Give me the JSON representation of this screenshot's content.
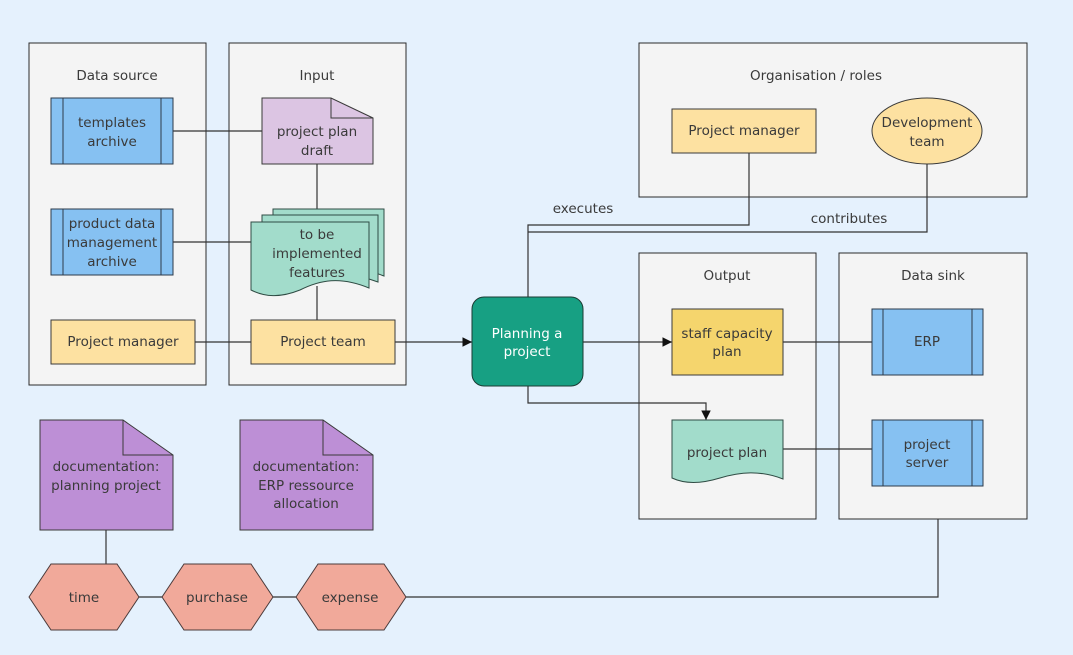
{
  "containers": {
    "data_source": "Data source",
    "input": "Input",
    "organisation": "Organisation / roles",
    "output": "Output",
    "data_sink": "Data sink"
  },
  "data_source": {
    "templates_archive": [
      "templates",
      "archive"
    ],
    "pdm_archive": [
      "product data",
      "management",
      "archive"
    ],
    "project_manager": "Project manager"
  },
  "input": {
    "project_plan_draft": [
      "project plan",
      "draft"
    ],
    "features": [
      "to be",
      "implemented",
      "features"
    ],
    "project_team": "Project team"
  },
  "process": {
    "label": [
      "Planning a",
      "project"
    ]
  },
  "organisation": {
    "project_manager": "Project manager",
    "development_team": [
      "Development",
      "team"
    ]
  },
  "edges": {
    "executes": "executes",
    "contributes": "contributes"
  },
  "output": {
    "staff_capacity_plan": [
      "staff capacity",
      "plan"
    ],
    "project_plan": "project plan"
  },
  "data_sink": {
    "erp": "ERP",
    "project_server": [
      "project",
      "server"
    ]
  },
  "documentation": {
    "planning_project": [
      "documentation:",
      "planning project"
    ],
    "erp_allocation": [
      "documentation:",
      "ERP ressource",
      "allocation"
    ]
  },
  "bookings": [
    "time",
    "purchase",
    "expense"
  ],
  "colors": {
    "background": "#e5f1fd",
    "container": "#f4f4f4",
    "system": "#86c1f2",
    "role": "#fde1a1",
    "output_doc": "#f5d56d",
    "draft": "#dcc5e3",
    "document": "#a2dccb",
    "documentation": "#bd8fd6",
    "booking": "#f1a99a",
    "process": "#17a083"
  }
}
